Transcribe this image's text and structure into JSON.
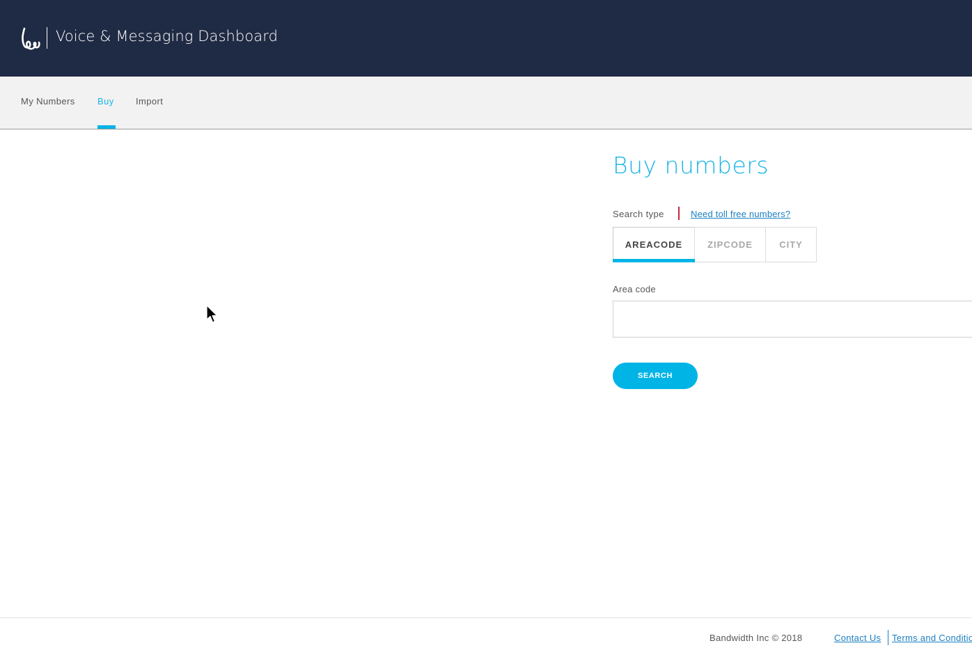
{
  "header": {
    "title": "Voice & Messaging Dashboard",
    "logo_icon": "bandwidth-logo-icon",
    "background_color": "#1f2a44"
  },
  "subnav": {
    "items": [
      {
        "label": "My Numbers",
        "active": false
      },
      {
        "label": "Buy",
        "active": true
      },
      {
        "label": "Import",
        "active": false
      }
    ],
    "accent_color": "#00b4e6"
  },
  "buy": {
    "title": "Buy numbers",
    "search_type_label": "Search type",
    "toll_free_link": "Need toll free numbers?",
    "search_types": [
      {
        "label": "AREACODE",
        "active": true
      },
      {
        "label": "ZIPCODE",
        "active": false
      },
      {
        "label": "CITY",
        "active": false
      }
    ],
    "area_code_label": "Area code",
    "area_code_value": "",
    "area_code_placeholder": "",
    "search_button": "SEARCH"
  },
  "footer": {
    "copyright": "Bandwidth Inc © 2018",
    "contact": "Contact Us",
    "terms": "Terms and Conditions"
  }
}
